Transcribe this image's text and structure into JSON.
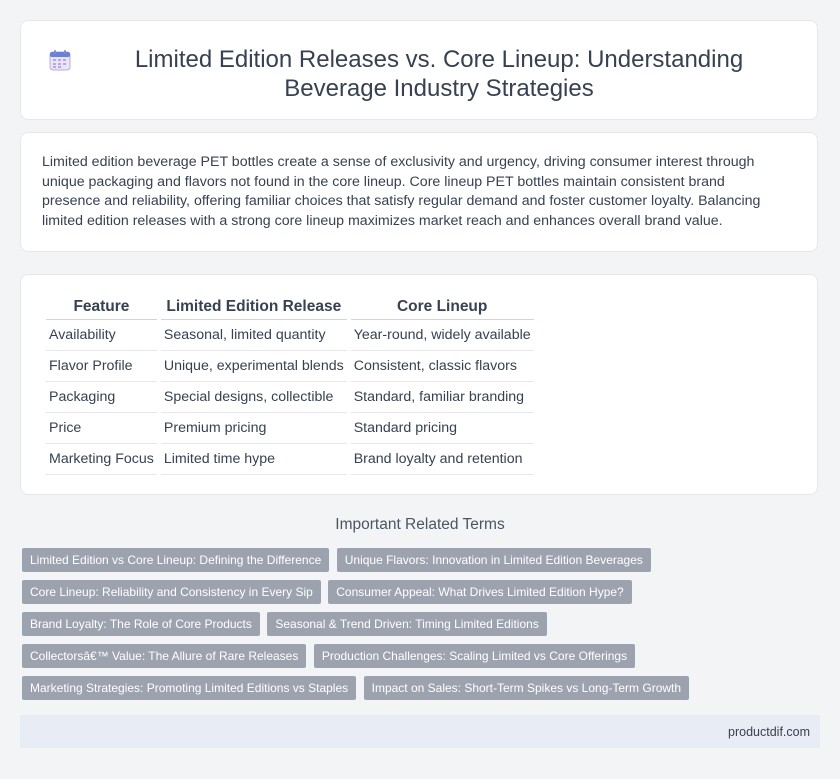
{
  "title": "Limited Edition Releases vs. Core Lineup: Understanding Beverage Industry Strategies",
  "icon": "calendar-icon",
  "intro": "Limited edition beverage PET bottles create a sense of exclusivity and urgency, driving consumer interest through unique packaging and flavors not found in the core lineup. Core lineup PET bottles maintain consistent brand presence and reliability, offering familiar choices that satisfy regular demand and foster customer loyalty. Balancing limited edition releases with a strong core lineup maximizes market reach and enhances overall brand value.",
  "table": {
    "headers": [
      "Feature",
      "Limited Edition Release",
      "Core Lineup"
    ],
    "rows": [
      [
        "Availability",
        "Seasonal, limited quantity",
        "Year-round, widely available"
      ],
      [
        "Flavor Profile",
        "Unique, experimental blends",
        "Consistent, classic flavors"
      ],
      [
        "Packaging",
        "Special designs, collectible",
        "Standard, familiar branding"
      ],
      [
        "Price",
        "Premium pricing",
        "Standard pricing"
      ],
      [
        "Marketing Focus",
        "Limited time hype",
        "Brand loyalty and retention"
      ]
    ]
  },
  "terms_heading": "Important Related Terms",
  "terms": [
    "Limited Edition vs Core Lineup: Defining the Difference",
    "Unique Flavors: Innovation in Limited Edition Beverages",
    "Core Lineup: Reliability and Consistency in Every Sip",
    "Consumer Appeal: What Drives Limited Edition Hype?",
    "Brand Loyalty: The Role of Core Products",
    "Seasonal & Trend Driven: Timing Limited Editions",
    "Collectorsâ€™ Value: The Allure of Rare Releases",
    "Production Challenges: Scaling Limited vs Core Offerings",
    "Marketing Strategies: Promoting Limited Editions vs Staples",
    "Impact on Sales: Short-Term Spikes vs Long-Term Growth"
  ],
  "footer": "productdif.com"
}
